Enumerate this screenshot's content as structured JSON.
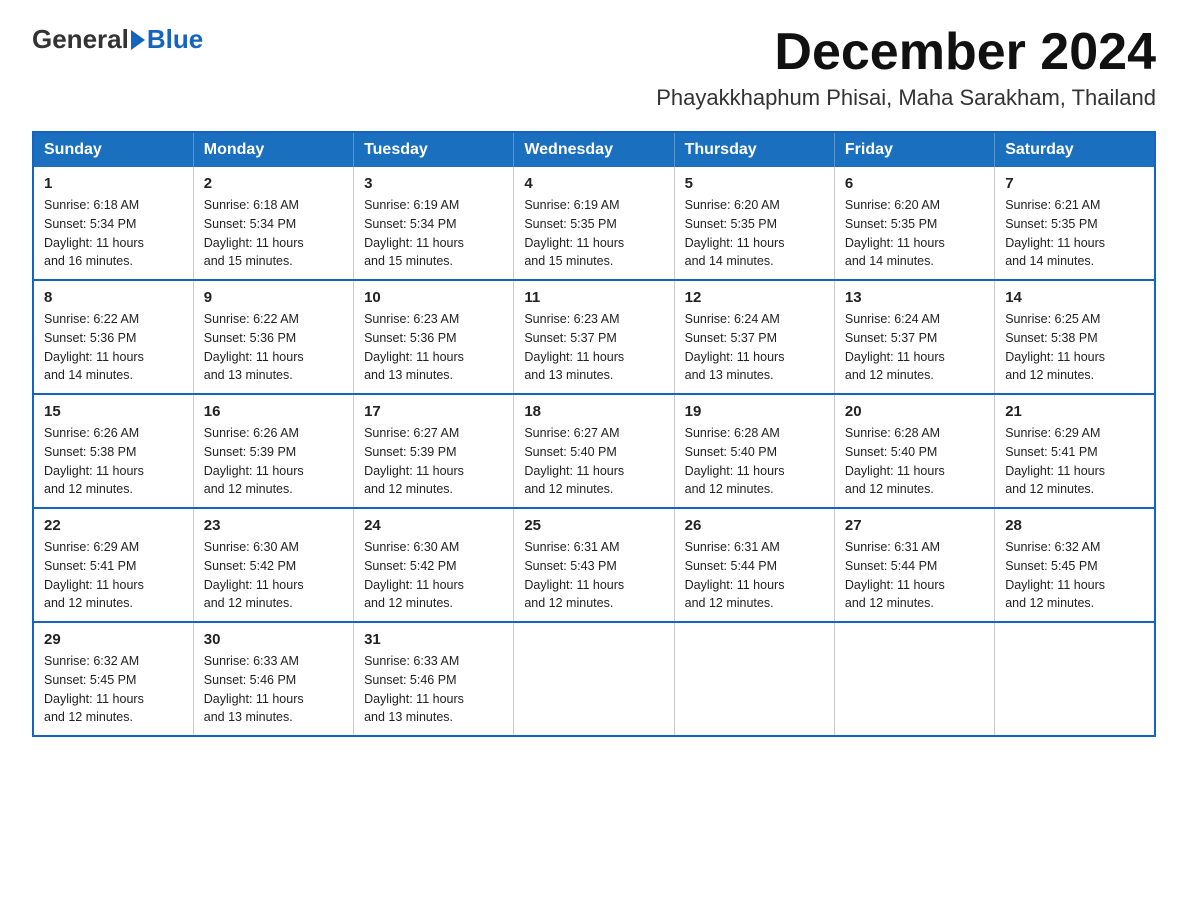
{
  "header": {
    "logo_general": "General",
    "logo_blue": "Blue",
    "month_title": "December 2024",
    "location": "Phayakkhaphum Phisai, Maha Sarakham, Thailand"
  },
  "weekdays": [
    "Sunday",
    "Monday",
    "Tuesday",
    "Wednesday",
    "Thursday",
    "Friday",
    "Saturday"
  ],
  "weeks": [
    [
      {
        "day": "1",
        "sunrise": "6:18 AM",
        "sunset": "5:34 PM",
        "daylight": "11 hours and 16 minutes."
      },
      {
        "day": "2",
        "sunrise": "6:18 AM",
        "sunset": "5:34 PM",
        "daylight": "11 hours and 15 minutes."
      },
      {
        "day": "3",
        "sunrise": "6:19 AM",
        "sunset": "5:34 PM",
        "daylight": "11 hours and 15 minutes."
      },
      {
        "day": "4",
        "sunrise": "6:19 AM",
        "sunset": "5:35 PM",
        "daylight": "11 hours and 15 minutes."
      },
      {
        "day": "5",
        "sunrise": "6:20 AM",
        "sunset": "5:35 PM",
        "daylight": "11 hours and 14 minutes."
      },
      {
        "day": "6",
        "sunrise": "6:20 AM",
        "sunset": "5:35 PM",
        "daylight": "11 hours and 14 minutes."
      },
      {
        "day": "7",
        "sunrise": "6:21 AM",
        "sunset": "5:35 PM",
        "daylight": "11 hours and 14 minutes."
      }
    ],
    [
      {
        "day": "8",
        "sunrise": "6:22 AM",
        "sunset": "5:36 PM",
        "daylight": "11 hours and 14 minutes."
      },
      {
        "day": "9",
        "sunrise": "6:22 AM",
        "sunset": "5:36 PM",
        "daylight": "11 hours and 13 minutes."
      },
      {
        "day": "10",
        "sunrise": "6:23 AM",
        "sunset": "5:36 PM",
        "daylight": "11 hours and 13 minutes."
      },
      {
        "day": "11",
        "sunrise": "6:23 AM",
        "sunset": "5:37 PM",
        "daylight": "11 hours and 13 minutes."
      },
      {
        "day": "12",
        "sunrise": "6:24 AM",
        "sunset": "5:37 PM",
        "daylight": "11 hours and 13 minutes."
      },
      {
        "day": "13",
        "sunrise": "6:24 AM",
        "sunset": "5:37 PM",
        "daylight": "11 hours and 12 minutes."
      },
      {
        "day": "14",
        "sunrise": "6:25 AM",
        "sunset": "5:38 PM",
        "daylight": "11 hours and 12 minutes."
      }
    ],
    [
      {
        "day": "15",
        "sunrise": "6:26 AM",
        "sunset": "5:38 PM",
        "daylight": "11 hours and 12 minutes."
      },
      {
        "day": "16",
        "sunrise": "6:26 AM",
        "sunset": "5:39 PM",
        "daylight": "11 hours and 12 minutes."
      },
      {
        "day": "17",
        "sunrise": "6:27 AM",
        "sunset": "5:39 PM",
        "daylight": "11 hours and 12 minutes."
      },
      {
        "day": "18",
        "sunrise": "6:27 AM",
        "sunset": "5:40 PM",
        "daylight": "11 hours and 12 minutes."
      },
      {
        "day": "19",
        "sunrise": "6:28 AM",
        "sunset": "5:40 PM",
        "daylight": "11 hours and 12 minutes."
      },
      {
        "day": "20",
        "sunrise": "6:28 AM",
        "sunset": "5:40 PM",
        "daylight": "11 hours and 12 minutes."
      },
      {
        "day": "21",
        "sunrise": "6:29 AM",
        "sunset": "5:41 PM",
        "daylight": "11 hours and 12 minutes."
      }
    ],
    [
      {
        "day": "22",
        "sunrise": "6:29 AM",
        "sunset": "5:41 PM",
        "daylight": "11 hours and 12 minutes."
      },
      {
        "day": "23",
        "sunrise": "6:30 AM",
        "sunset": "5:42 PM",
        "daylight": "11 hours and 12 minutes."
      },
      {
        "day": "24",
        "sunrise": "6:30 AM",
        "sunset": "5:42 PM",
        "daylight": "11 hours and 12 minutes."
      },
      {
        "day": "25",
        "sunrise": "6:31 AM",
        "sunset": "5:43 PM",
        "daylight": "11 hours and 12 minutes."
      },
      {
        "day": "26",
        "sunrise": "6:31 AM",
        "sunset": "5:44 PM",
        "daylight": "11 hours and 12 minutes."
      },
      {
        "day": "27",
        "sunrise": "6:31 AM",
        "sunset": "5:44 PM",
        "daylight": "11 hours and 12 minutes."
      },
      {
        "day": "28",
        "sunrise": "6:32 AM",
        "sunset": "5:45 PM",
        "daylight": "11 hours and 12 minutes."
      }
    ],
    [
      {
        "day": "29",
        "sunrise": "6:32 AM",
        "sunset": "5:45 PM",
        "daylight": "11 hours and 12 minutes."
      },
      {
        "day": "30",
        "sunrise": "6:33 AM",
        "sunset": "5:46 PM",
        "daylight": "11 hours and 13 minutes."
      },
      {
        "day": "31",
        "sunrise": "6:33 AM",
        "sunset": "5:46 PM",
        "daylight": "11 hours and 13 minutes."
      },
      null,
      null,
      null,
      null
    ]
  ]
}
